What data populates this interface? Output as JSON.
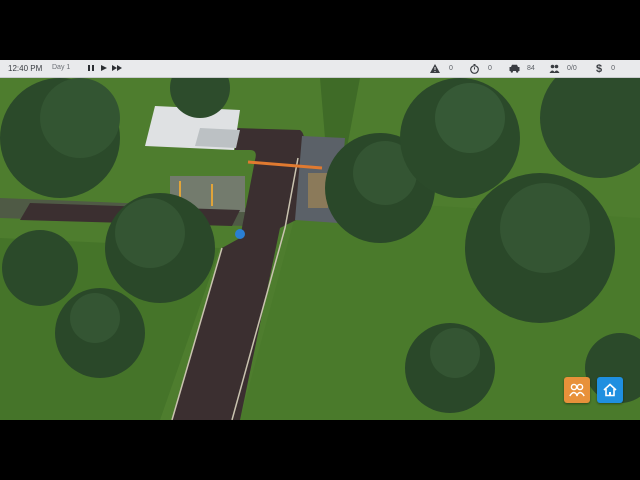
{
  "hud": {
    "time": "12:40 PM",
    "day": "Day 1",
    "stats": {
      "alerts": "0",
      "timer": "0",
      "vehicles": "84",
      "people": "0/0",
      "money": "0"
    }
  },
  "colors": {
    "grass": "#4e7d2e",
    "road": "#3b2f30",
    "people_button": "#e8913a",
    "home_button": "#1f8fe0"
  },
  "icons": {
    "pause": "pause-icon",
    "play": "play-icon",
    "fast_forward": "fast-forward-icon",
    "alerts": "warning-icon",
    "timer": "stopwatch-icon",
    "vehicles": "car-icon",
    "people": "people-icon",
    "money": "dollar-icon",
    "people_button": "people-icon",
    "home_button": "home-icon"
  }
}
